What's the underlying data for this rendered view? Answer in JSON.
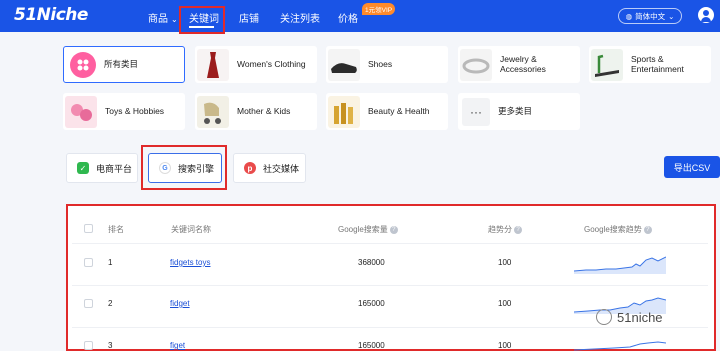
{
  "nav": {
    "logo": "51Niche",
    "items": [
      "商品",
      "关键词",
      "店铺",
      "关注列表",
      "价格"
    ],
    "vip_badge": "1元领VIP",
    "language": "简体中文"
  },
  "categories": [
    {
      "label": "所有类目"
    },
    {
      "label": "Women's Clothing"
    },
    {
      "label": "Shoes"
    },
    {
      "label": "Jewelry & Accessories"
    },
    {
      "label": "Sports & Entertainment"
    },
    {
      "label": "Toys & Hobbies"
    },
    {
      "label": "Mother & Kids"
    },
    {
      "label": "Beauty & Health"
    },
    {
      "label": "更多类目"
    }
  ],
  "platform_tabs": [
    "电商平台",
    "搜索引擎",
    "社交媒体"
  ],
  "export_label": "导出CSV",
  "table": {
    "headers": [
      "排名",
      "关键词名称",
      "Google搜索量",
      "趋势分",
      "Google搜索趋势"
    ],
    "rows": [
      {
        "rank": "1",
        "keyword": "fidgets toys",
        "volume": "368000",
        "score": "100"
      },
      {
        "rank": "2",
        "keyword": "fidget",
        "volume": "165000",
        "score": "100"
      },
      {
        "rank": "3",
        "keyword": "figet",
        "volume": "165000",
        "score": "100"
      }
    ]
  },
  "watermark": "51niche",
  "colors": {
    "brand": "#1a54e6",
    "highlight": "#e02a2a",
    "link": "#1a4fd6"
  }
}
